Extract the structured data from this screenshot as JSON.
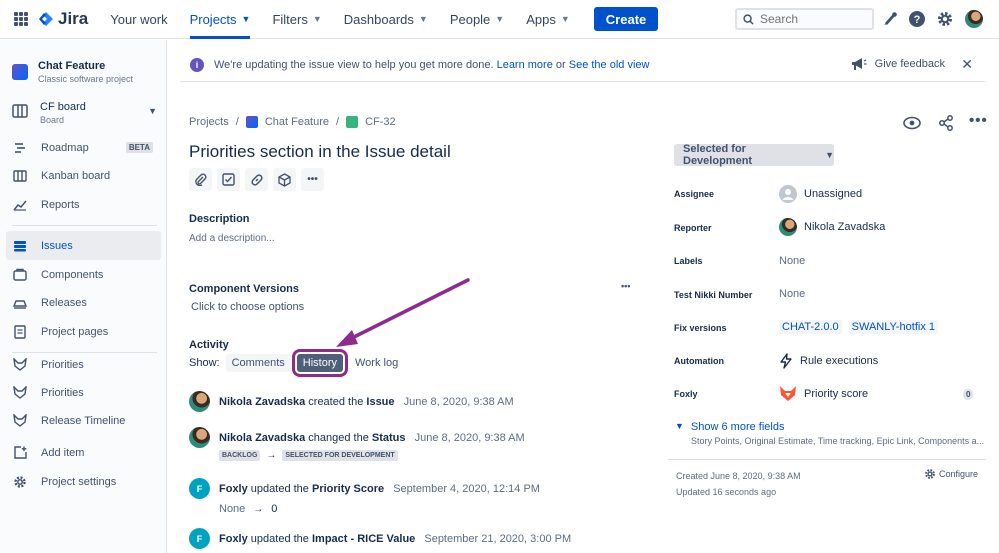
{
  "topnav": {
    "logo": "Jira",
    "items": [
      {
        "label": "Your work",
        "dropdown": false
      },
      {
        "label": "Projects",
        "dropdown": true,
        "active": true
      },
      {
        "label": "Filters",
        "dropdown": true
      },
      {
        "label": "Dashboards",
        "dropdown": true
      },
      {
        "label": "People",
        "dropdown": true
      },
      {
        "label": "Apps",
        "dropdown": true
      }
    ],
    "create_label": "Create",
    "search_placeholder": "Search"
  },
  "sidebar": {
    "project_name": "Chat Feature",
    "project_type": "Classic software project",
    "board_name": "CF board",
    "board_sub": "Board",
    "items": [
      {
        "label": "Roadmap",
        "icon": "roadmap-icon",
        "badge": "BETA"
      },
      {
        "label": "Kanban board",
        "icon": "kanban-icon"
      },
      {
        "label": "Reports",
        "icon": "reports-icon"
      },
      {
        "label": "Issues",
        "icon": "issues-icon",
        "active": true
      },
      {
        "label": "Components",
        "icon": "components-icon"
      },
      {
        "label": "Releases",
        "icon": "releases-icon"
      },
      {
        "label": "Project pages",
        "icon": "pages-icon"
      },
      {
        "label": "Priorities",
        "icon": "foxly-icon"
      },
      {
        "label": "Priorities",
        "icon": "foxly-icon"
      },
      {
        "label": "Release Timeline",
        "icon": "foxly-icon"
      },
      {
        "label": "Add item",
        "icon": "add-item-icon"
      },
      {
        "label": "Project settings",
        "icon": "gear-icon"
      }
    ]
  },
  "banner": {
    "text": "We're updating the issue view to help you get more done.",
    "link1": "Learn more",
    "or": "or",
    "link2": "See the old view",
    "feedback": "Give feedback"
  },
  "issue": {
    "breadcrumb": [
      "Projects",
      "Chat Feature",
      "CF-32"
    ],
    "title": "Priorities section in the Issue detail",
    "description_heading": "Description",
    "description_placeholder": "Add a description...",
    "component_heading": "Component Versions",
    "component_placeholder": "Click to choose options",
    "activity_heading": "Activity",
    "show_label": "Show:",
    "tabs": [
      "Comments",
      "History",
      "Work log"
    ],
    "selected_tab": "History",
    "history": [
      {
        "avatar": "photo",
        "user": "Nikola Zavadska",
        "action": "created the",
        "field": "Issue",
        "time": "June 8, 2020, 9:38 AM"
      },
      {
        "avatar": "photo",
        "user": "Nikola Zavadska",
        "action": "changed the",
        "field": "Status",
        "time": "June 8, 2020, 9:38 AM",
        "from": "BACKLOG",
        "to": "SELECTED FOR DEVELOPMENT"
      },
      {
        "avatar": "F",
        "user": "Foxly",
        "action": "updated the",
        "field": "Priority Score",
        "time": "September 4, 2020, 12:14 PM",
        "from": "None",
        "to": "0"
      },
      {
        "avatar": "F",
        "user": "Foxly",
        "action": "updated the",
        "field": "Impact - RICE Value",
        "time": "September 21, 2020, 3:00 PM"
      }
    ]
  },
  "details": {
    "status": "Selected for Development",
    "fields": [
      {
        "label": "Assignee",
        "value": "Unassigned"
      },
      {
        "label": "Reporter",
        "value": "Nikola Zavadska"
      },
      {
        "label": "Labels",
        "value": "None"
      },
      {
        "label": "Test Nikki Number",
        "value": "None"
      },
      {
        "label": "Fix versions",
        "values": [
          "CHAT-2.0.0",
          "SWANLY-hotfix 1"
        ]
      },
      {
        "label": "Automation",
        "value": "Rule executions"
      },
      {
        "label": "Foxly",
        "value": "Priority score",
        "count": "0"
      }
    ],
    "show_more": "Show 6 more fields",
    "show_more_sub": "Story Points, Original Estimate, Time tracking, Epic Link, Components a...",
    "created": "Created June 8, 2020, 9:38 AM",
    "updated": "Updated 16 seconds ago",
    "configure": "Configure"
  },
  "colors": {
    "accent": "#0052cc",
    "annotation": "#8e2b8e"
  }
}
